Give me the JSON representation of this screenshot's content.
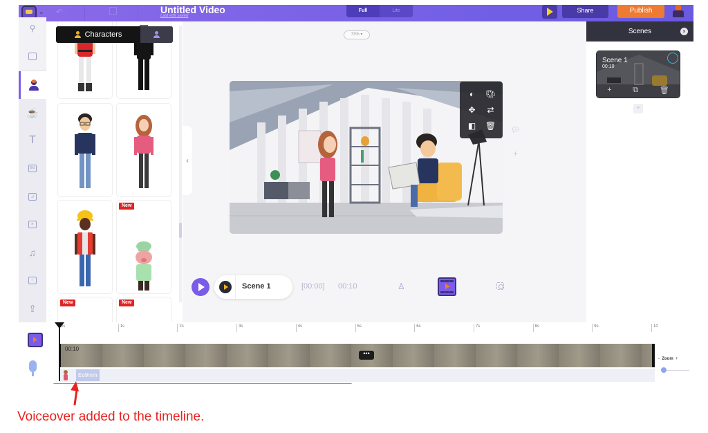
{
  "topbar": {
    "title": "Untitled Video",
    "subtitle": "Last edit saved",
    "mode_options": [
      "Full",
      "Lite"
    ],
    "mode_selected": "Full",
    "share_label": "Share",
    "publish_label": "Publish"
  },
  "sidebar": {
    "items": [
      {
        "name": "search",
        "icon": "search-icon"
      },
      {
        "name": "properties",
        "icon": "box-icon"
      },
      {
        "name": "characters",
        "icon": "character-icon",
        "active": true
      },
      {
        "name": "props",
        "icon": "cup-icon"
      },
      {
        "name": "text",
        "icon": "text-icon",
        "glyph": "T"
      },
      {
        "name": "backgrounds",
        "icon": "bg-icon",
        "glyph": "BG"
      },
      {
        "name": "images",
        "icon": "image-icon"
      },
      {
        "name": "videos",
        "icon": "film-icon"
      },
      {
        "name": "music",
        "icon": "music-icon",
        "glyph": "♫"
      },
      {
        "name": "effects",
        "icon": "effects-icon"
      },
      {
        "name": "upload",
        "icon": "upload-icon",
        "glyph": "⇪"
      }
    ]
  },
  "characters_panel": {
    "tab_label": "Characters",
    "badge_new": "New",
    "collapse_glyph": "‹"
  },
  "canvas": {
    "zoom_level": "73%",
    "toolbar_icons": [
      "contrast-icon",
      "palette-icon",
      "move-icon",
      "swap-icon",
      "flip-icon",
      "trash-icon"
    ]
  },
  "player": {
    "scene_label": "Scene 1",
    "time_start": "[00:00]",
    "duration": "00:10"
  },
  "scenes_panel": {
    "title": "Scenes",
    "scenes": [
      {
        "name": "Scene 1",
        "duration": "00:10"
      }
    ]
  },
  "timeline": {
    "ticks": [
      "0s",
      "1s",
      "2s",
      "3s",
      "4s",
      "5s",
      "6s",
      "7s",
      "8s",
      "9s",
      "10"
    ],
    "scene_track_time": "00:10",
    "voiceover_label": "Eo9mm",
    "zoom_label": "Zoom",
    "zoom_minus": "-",
    "zoom_plus": "+",
    "zoom_value": 0
  },
  "annotation": {
    "caption": "Voiceover added to the timeline."
  },
  "colors": {
    "accent": "#7a5ce8",
    "publish": "#ee7b33",
    "annotation": "#e8221f"
  }
}
